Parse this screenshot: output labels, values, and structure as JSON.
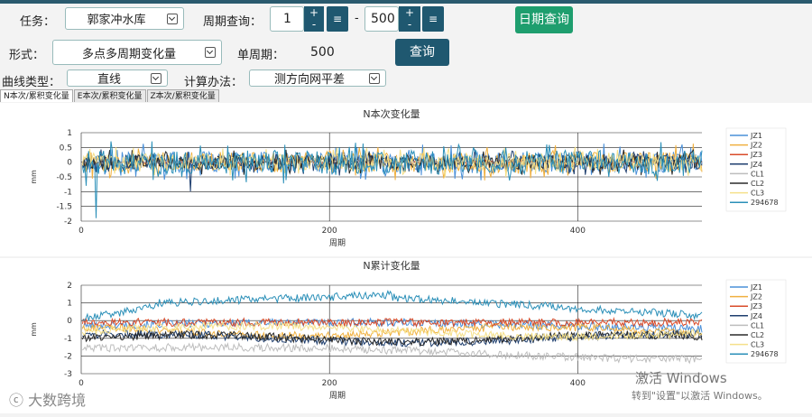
{
  "toolbar": {
    "task_label": "任务：",
    "task_value": "郭家冲水库",
    "period_query_label": "周期查询：",
    "period_from": "1",
    "dash": "-",
    "period_to": "500",
    "plus": "+",
    "minus": "-",
    "list_glyph": "≡",
    "date_query_button": "日期查询",
    "form_label": "形式：",
    "form_value": "多点多周期变化量",
    "single_period_label": "单周期：",
    "single_period_value": "500",
    "query_button": "查询",
    "curve_type_label": "曲线类型：",
    "curve_type_value": "直线",
    "calc_method_label": "计算办法：",
    "calc_method_value": "测方向网平差"
  },
  "tabs": [
    {
      "label": "N本次/累积变化量",
      "active": true
    },
    {
      "label": "E本次/累积变化量",
      "active": false
    },
    {
      "label": "Z本次/累积变化量",
      "active": false
    }
  ],
  "legend": [
    "JZ1",
    "JZ2",
    "JZ3",
    "JZ4",
    "CL1",
    "CL2",
    "CL3",
    "294678"
  ],
  "colors": {
    "accent": "#1f5870",
    "date_button": "#1e9e6e",
    "JZ1": "#4a90d9",
    "JZ2": "#f0b040",
    "JZ3": "#d94c2a",
    "JZ4": "#1f3f6f",
    "CL1": "#bdbdbd",
    "CL2": "#2a2a2a",
    "CL3": "#f5e08a",
    "294678": "#2a8fb8"
  },
  "chart_data": [
    {
      "type": "line",
      "title": "N本次变化量",
      "xlabel": "周期",
      "ylabel": "mm",
      "xlim": [
        0,
        500
      ],
      "ylim": [
        -2,
        1
      ],
      "xticks": [
        0,
        200,
        400
      ],
      "yticks": [
        1,
        0.5,
        0,
        -0.5,
        -1,
        -1.5,
        -2
      ],
      "grid": "horizontal + vertical at 200, 400",
      "legend_position": "right",
      "series_summary": "8 series (JZ1, JZ2, JZ3, JZ4, CL1, CL2, CL3, 294678) fluctuating around 0 roughly within ±0.5 mm across periods 1–500; spikes to about -1.9 near period 12 and about -1.0 near period 88"
    },
    {
      "type": "line",
      "title": "N累计变化量",
      "xlabel": "周期",
      "ylabel": "mm",
      "xlim": [
        0,
        500
      ],
      "ylim": [
        -3,
        2
      ],
      "xticks": [
        0,
        200,
        400
      ],
      "yticks": [
        2,
        1,
        0,
        -1,
        -2,
        -3
      ],
      "grid": "horizontal + vertical at 200, 400",
      "legend_position": "right",
      "series_summary": "294678 rises from about 0 to about 1–1.5 mm, then declines to about 0.3 mm; CL2 around -1 mm; CL1 around -1.5 to -2 mm; CL3 around -0.5 mm"
    }
  ],
  "watermark": {
    "activate_line1": "激活 Windows",
    "activate_line2": "转到\"设置\"以激活 Windows。",
    "brand": "大数跨境"
  }
}
